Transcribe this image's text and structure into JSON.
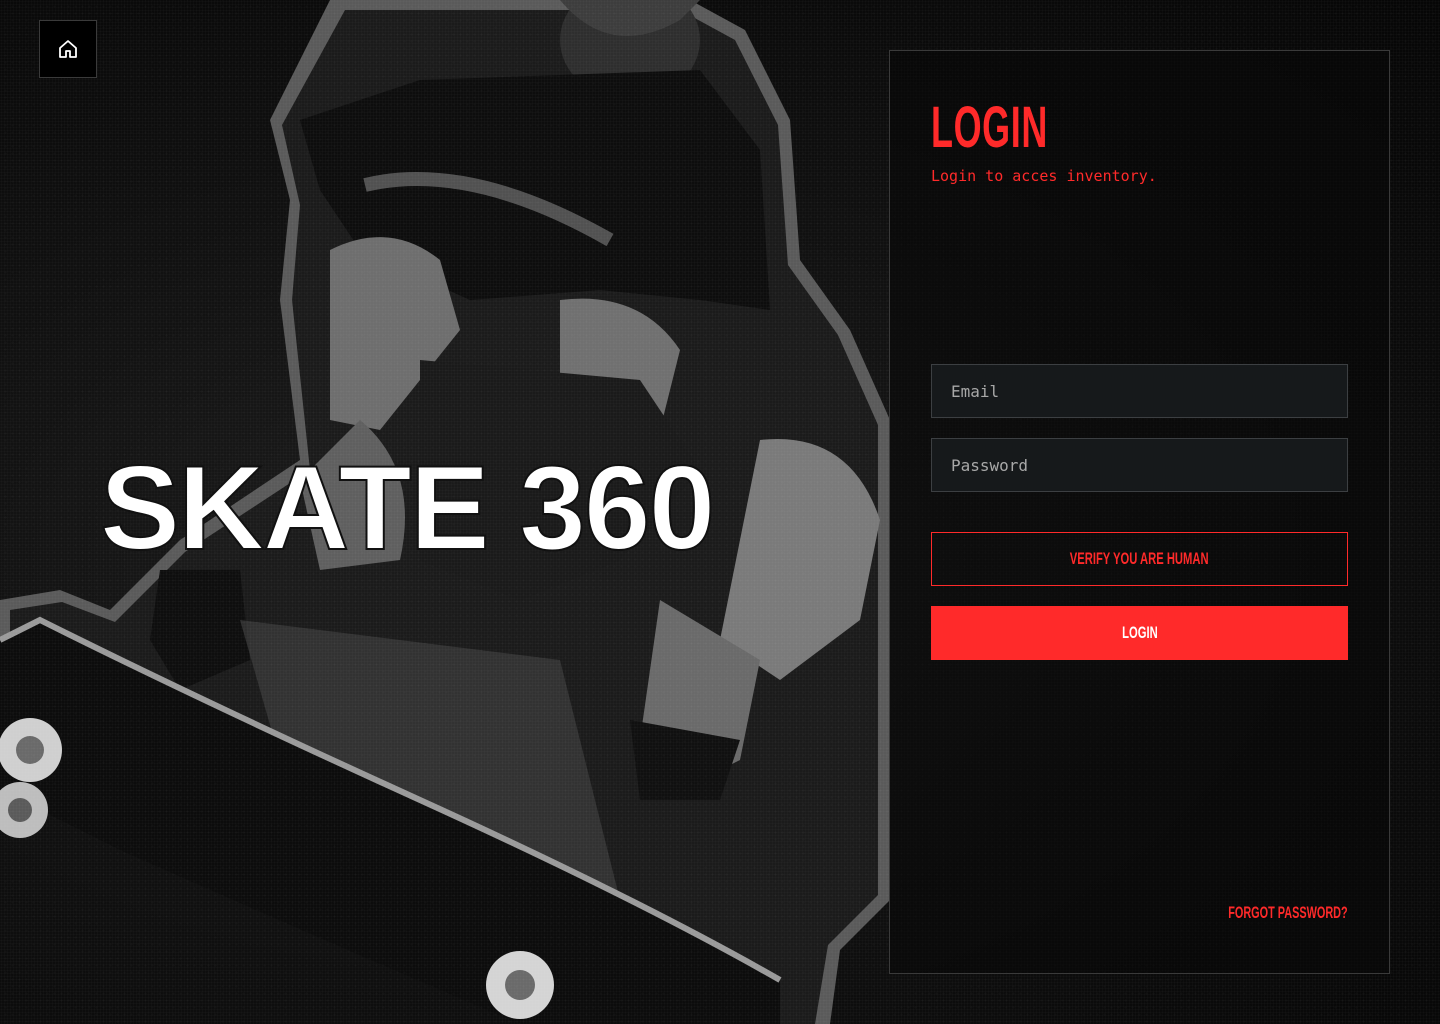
{
  "page": {
    "background_color": "#0b0b0b",
    "accent_color": "#ff2a2a"
  },
  "hero": {
    "brand": "SKATE 360",
    "image": "skateboarder-photo"
  },
  "nav": {
    "home_icon": "home-icon"
  },
  "login": {
    "title": "LOGIN",
    "subtitle": "Login to acces inventory.",
    "email_placeholder": "Email",
    "password_placeholder": "Password",
    "verify_label": "VERIFY YOU ARE HUMAN",
    "login_label": "LOGIN",
    "forgot_label": "FORGOT PASSWORD?"
  }
}
